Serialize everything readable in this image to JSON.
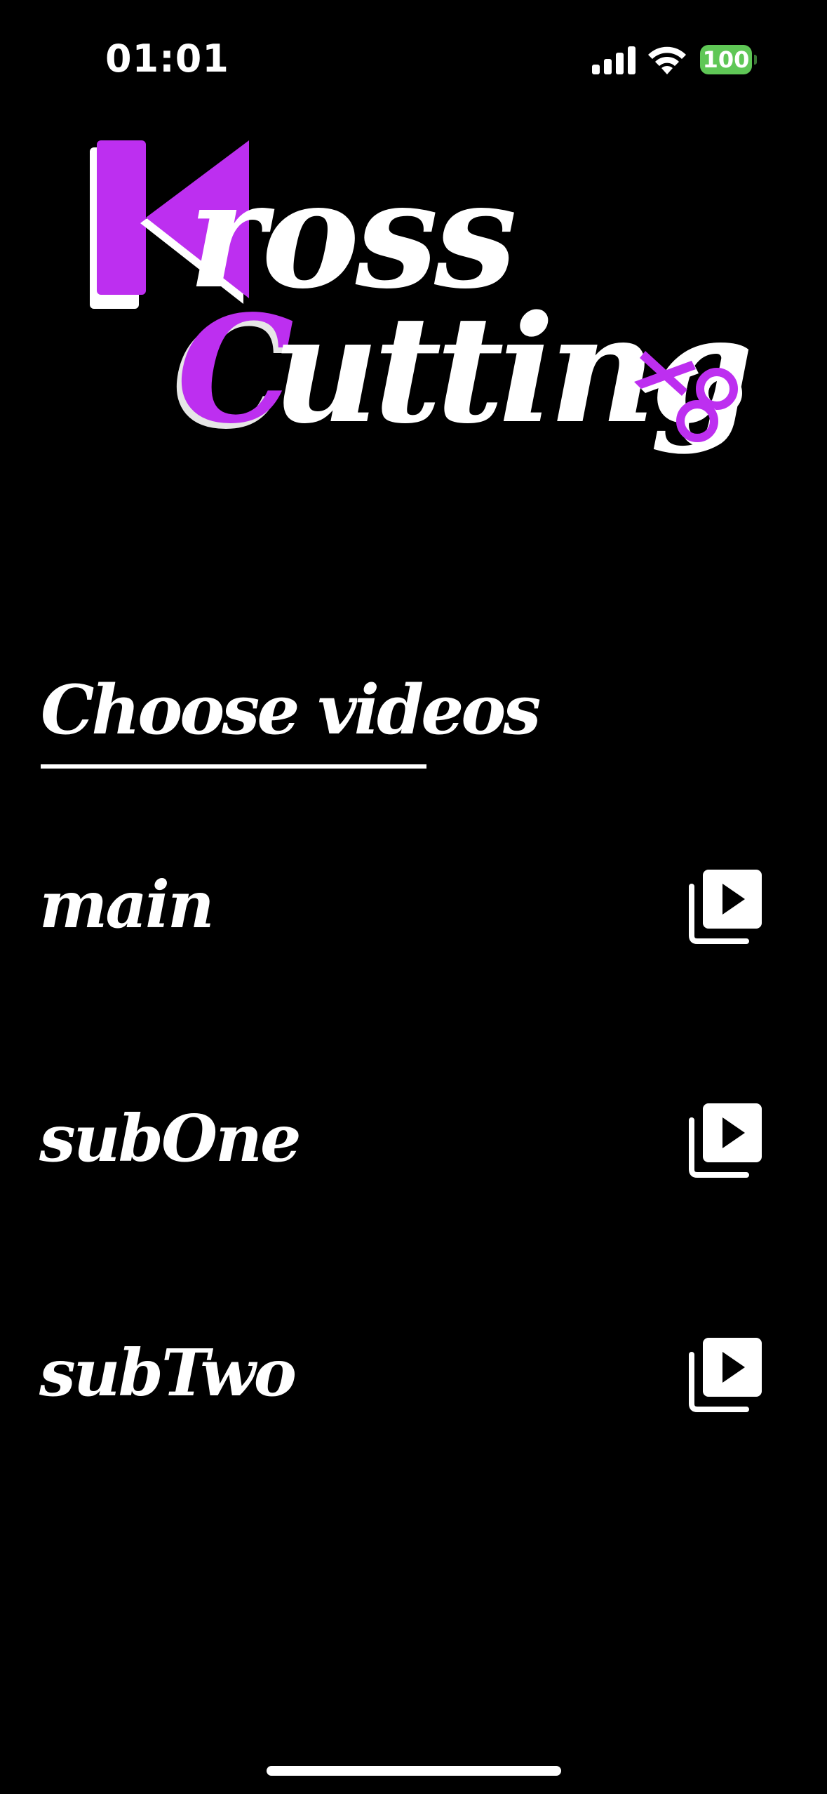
{
  "status_bar": {
    "time": "01:01",
    "battery_level": "100",
    "battery_color": "#5fc756",
    "icons": [
      "cellular-signal-icon",
      "wifi-icon",
      "battery-icon"
    ]
  },
  "logo": {
    "line1": "Kross",
    "line2": "Cutting",
    "accent_color": "#bd2ff0",
    "icon": "scissors-icon"
  },
  "section": {
    "title": "Choose videos"
  },
  "videos": [
    {
      "label": "main",
      "icon": "video-library-icon"
    },
    {
      "label": "subOne",
      "icon": "video-library-icon"
    },
    {
      "label": "subTwo",
      "icon": "video-library-icon"
    }
  ],
  "colors": {
    "background": "#000000",
    "text": "#ffffff",
    "accent": "#bd2ff0"
  }
}
